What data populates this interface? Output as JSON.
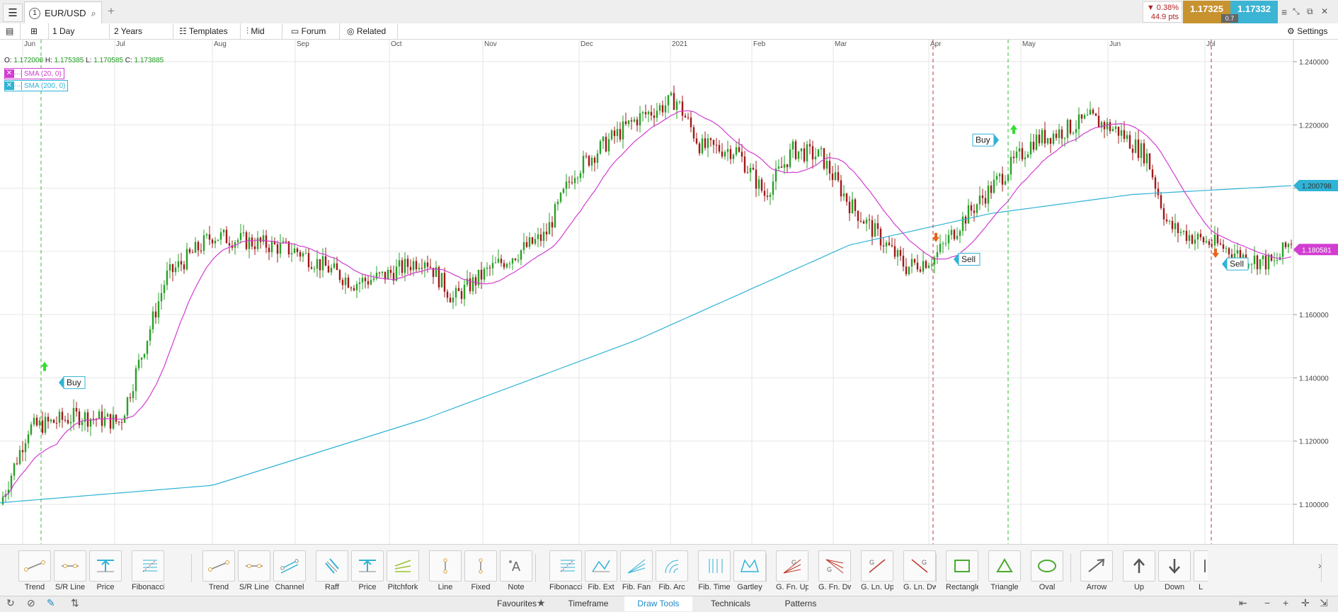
{
  "tabbar": {
    "tab_number": "1",
    "symbol": "EUR/USD",
    "add_tab": "+",
    "change_pct": "▼ 0.38%",
    "change_pts": "44.9 pts",
    "bid": "1.17325",
    "ask": "1.17332",
    "spread": "0.7"
  },
  "toolbar": {
    "interval": "1 Day",
    "range": "2 Years",
    "templates": "Templates",
    "price_type": "Mid",
    "forum": "Forum",
    "related": "Related",
    "settings": "Settings"
  },
  "ohlc": {
    "o_label": "O:",
    "o_value": "1.172000",
    "h_label": "H:",
    "h_value": "1.175385",
    "l_label": "L:",
    "l_value": "1.170585",
    "c_label": "C:",
    "c_value": "1.173885"
  },
  "indicators": [
    {
      "label": "SMA (20, 0)",
      "color": "#d23dd2"
    },
    {
      "label": "SMA (200, 0)",
      "color": "#2fb3d6"
    }
  ],
  "chart_data": {
    "type": "candlestick",
    "symbol": "EUR/USD",
    "x_ticks": [
      "Jun",
      "Jul",
      "Aug",
      "Sep",
      "Oct",
      "Nov",
      "Dec",
      "2021",
      "Feb",
      "Mar",
      "Apr",
      "May",
      "Jun",
      "Jul"
    ],
    "y_ticks": [
      "1.240000",
      "1.220000",
      "1.200000",
      "1.180000",
      "1.160000",
      "1.140000",
      "1.120000",
      "1.100000"
    ],
    "ylim": [
      1.088,
      1.248
    ],
    "price_path_months": [
      {
        "m": "May 2020",
        "close": 1.1
      },
      {
        "m": "Jun 2020",
        "close": 1.124
      },
      {
        "m": "Jul 2020",
        "close": 1.125
      },
      {
        "m": "Jul end",
        "close": 1.175
      },
      {
        "m": "Aug 2020",
        "close": 1.185
      },
      {
        "m": "Sep 2020",
        "close": 1.175
      },
      {
        "m": "Oct 2020",
        "close": 1.17
      },
      {
        "m": "Nov 2020",
        "close": 1.168
      },
      {
        "m": "Dec 2020",
        "close": 1.215
      },
      {
        "m": "Jan 2021",
        "close": 1.23
      },
      {
        "m": "Feb 2021",
        "close": 1.205
      },
      {
        "m": "Mar 2021",
        "close": 1.21
      },
      {
        "m": "Apr 2021",
        "close": 1.175
      },
      {
        "m": "Apr end",
        "close": 1.215
      },
      {
        "m": "May 2021",
        "close": 1.222
      },
      {
        "m": "Jun 2021",
        "close": 1.215
      },
      {
        "m": "Jun end",
        "close": 1.185
      },
      {
        "m": "Jul 2021",
        "close": 1.178
      },
      {
        "m": "last",
        "close": 1.1739
      }
    ],
    "series": [
      {
        "name": "SMA (20, 0)",
        "color": "#d23dd2",
        "last_value": "1.180581"
      },
      {
        "name": "SMA (200, 0)",
        "color": "#2fb3d6",
        "last_value": "1.200798"
      }
    ],
    "signals": [
      {
        "label": "Buy",
        "type": "buy",
        "date": "Jun 2020"
      },
      {
        "label": "Sell",
        "type": "sell",
        "date": "Apr 2021"
      },
      {
        "label": "Buy",
        "type": "buy",
        "date": "Apr 2021"
      },
      {
        "label": "Sell",
        "type": "sell",
        "date": "Jul 2021"
      }
    ]
  },
  "tools": [
    {
      "label": "Trend",
      "icon": "trend-line-icon"
    },
    {
      "label": "S/R Line",
      "icon": "sr-line-icon"
    },
    {
      "label": "Price",
      "icon": "price-marker-icon"
    },
    {
      "label": "Fibonacci",
      "icon": "fibonacci-icon"
    },
    {
      "label": "Trend",
      "icon": "trend-line-icon"
    },
    {
      "label": "S/R Line",
      "icon": "sr-line-icon"
    },
    {
      "label": "Channel",
      "icon": "channel-icon"
    },
    {
      "label": "Raff",
      "icon": "raff-icon"
    },
    {
      "label": "Price",
      "icon": "price-marker-icon"
    },
    {
      "label": "Pitchfork",
      "icon": "pitchfork-icon"
    },
    {
      "label": "Line",
      "icon": "vertical-line-icon"
    },
    {
      "label": "Fixed",
      "icon": "fixed-line-icon"
    },
    {
      "label": "Note",
      "icon": "note-icon"
    },
    {
      "label": "Fibonacci",
      "icon": "fibonacci-icon"
    },
    {
      "label": "Fib. Ext",
      "icon": "fib-extension-icon"
    },
    {
      "label": "Fib. Fan",
      "icon": "fib-fan-icon"
    },
    {
      "label": "Fib. Arc",
      "icon": "fib-arc-icon"
    },
    {
      "label": "Fib. Time",
      "icon": "fib-time-icon"
    },
    {
      "label": "Gartley",
      "icon": "gartley-icon"
    },
    {
      "label": "G. Fn. Up",
      "icon": "gann-fan-up-icon"
    },
    {
      "label": "G. Fn. Dwn",
      "icon": "gann-fan-down-icon"
    },
    {
      "label": "G. Ln. Up",
      "icon": "gann-line-up-icon"
    },
    {
      "label": "G. Ln. Dwn",
      "icon": "gann-line-down-icon"
    },
    {
      "label": "Rectangle",
      "icon": "rectangle-icon"
    },
    {
      "label": "Triangle",
      "icon": "triangle-icon"
    },
    {
      "label": "Oval",
      "icon": "oval-icon"
    },
    {
      "label": "Arrow",
      "icon": "arrow-icon"
    },
    {
      "label": "Up",
      "icon": "up-arrow-icon"
    },
    {
      "label": "Down",
      "icon": "down-arrow-icon"
    },
    {
      "label": "L",
      "icon": "label-icon"
    }
  ],
  "status": {
    "tabs": [
      "Favourites",
      "Timeframe",
      "Draw Tools",
      "Technicals",
      "Patterns"
    ],
    "active": "Draw Tools"
  }
}
